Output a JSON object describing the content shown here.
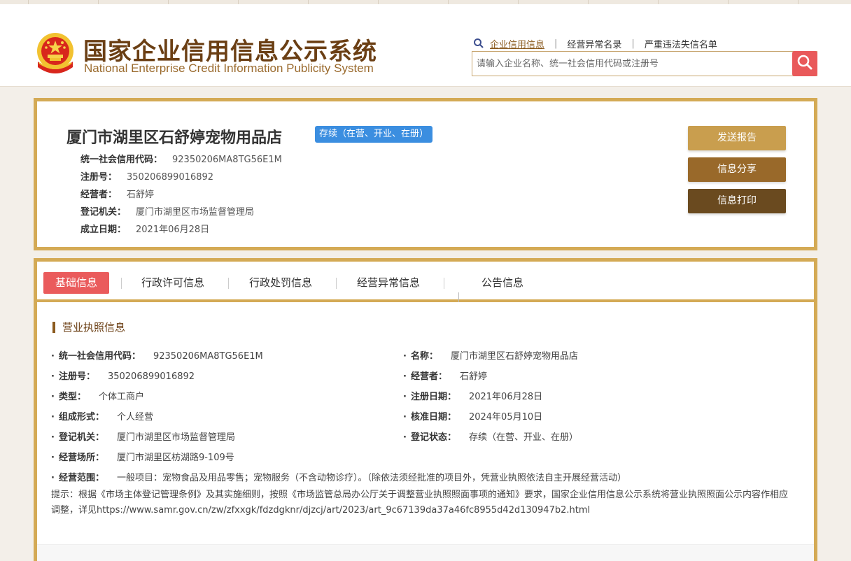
{
  "header": {
    "logo_cn": "国家企业信用信息公示系统",
    "logo_en": "National Enterprise Credit Information Publicity System",
    "nav": [
      {
        "label": "企业信用信息",
        "active": true
      },
      {
        "label": "经营异常名录",
        "active": false
      },
      {
        "label": "严重违法失信名单",
        "active": false
      }
    ],
    "nav_separator": "|",
    "search": {
      "placeholder": "请输入企业名称、统一社会信用代码或注册号",
      "value": ""
    }
  },
  "company": {
    "name": "厦门市湖里区石舒婷宠物用品店",
    "status": "存续（在营、开业、在册）",
    "fields": [
      {
        "label": "统一社会信用代码：",
        "value": "92350206MA8TG56E1M"
      },
      {
        "label": "注册号：",
        "value": "350206899016892"
      },
      {
        "label": "经营者：",
        "value": "石舒婷"
      },
      {
        "label": "登记机关：",
        "value": "厦门市湖里区市场监督管理局"
      },
      {
        "label": "成立日期：",
        "value": "2021年06月28日"
      }
    ],
    "actions": [
      {
        "label": "发送报告",
        "color": "#c99e4e"
      },
      {
        "label": "信息分享",
        "color": "#99692a"
      },
      {
        "label": "信息打印",
        "color": "#6a4a1f"
      }
    ]
  },
  "tabs": [
    {
      "label": "基础信息",
      "active": true
    },
    {
      "label": "行政许可信息",
      "active": false
    },
    {
      "label": "行政处罚信息",
      "active": false
    },
    {
      "label": "经营异常信息",
      "active": false
    },
    {
      "label": "公告信息",
      "active": false
    }
  ],
  "license": {
    "section_title": "营业执照信息",
    "bullet": "·",
    "left": [
      {
        "label": "统一社会信用代码：",
        "value": "92350206MA8TG56E1M"
      },
      {
        "label": "注册号：",
        "value": "350206899016892"
      },
      {
        "label": "类型：",
        "value": "个体工商户"
      },
      {
        "label": "组成形式：",
        "value": "个人经营"
      },
      {
        "label": "登记机关：",
        "value": "厦门市湖里区市场监督管理局"
      },
      {
        "label": "经营场所：",
        "value": "厦门市湖里区枋湖路9-109号"
      },
      {
        "label": "经营范围：",
        "value": "一般项目：宠物食品及用品零售；宠物服务（不含动物诊疗）。（除依法须经批准的项目外，凭营业执照依法自主开展经营活动）"
      }
    ],
    "right": [
      {
        "label": "名称：",
        "value": "厦门市湖里区石舒婷宠物用品店"
      },
      {
        "label": "经营者：",
        "value": "石舒婷"
      },
      {
        "label": "注册日期：",
        "value": "2021年06月28日"
      },
      {
        "label": "核准日期：",
        "value": "2024年05月10日"
      },
      {
        "label": "登记状态：",
        "value": "存续（在营、开业、在册）"
      }
    ],
    "hint": "提示：根据《市场主体登记管理条例》及其实施细则，按照《市场监管总局办公厅关于调整营业执照照面事项的通知》要求，国家企业信用信息公示系统将营业执照照面公示内容作相应调整，详见https://www.samr.gov.cn/zw/zfxxgk/fdzdgknr/djzcj/art/2023/art_9c67139da37a46fc8955d42d130947b2.html"
  },
  "colors": {
    "gold_border": "#d4aa55",
    "brand_brown": "#6b3f14",
    "tab_active": "#ea5b5c",
    "status_blue": "#3b8ee0",
    "search_red": "#e9595a"
  },
  "icons": [
    "national-emblem-icon",
    "search-magnifier-icon",
    "search-button-icon"
  ]
}
